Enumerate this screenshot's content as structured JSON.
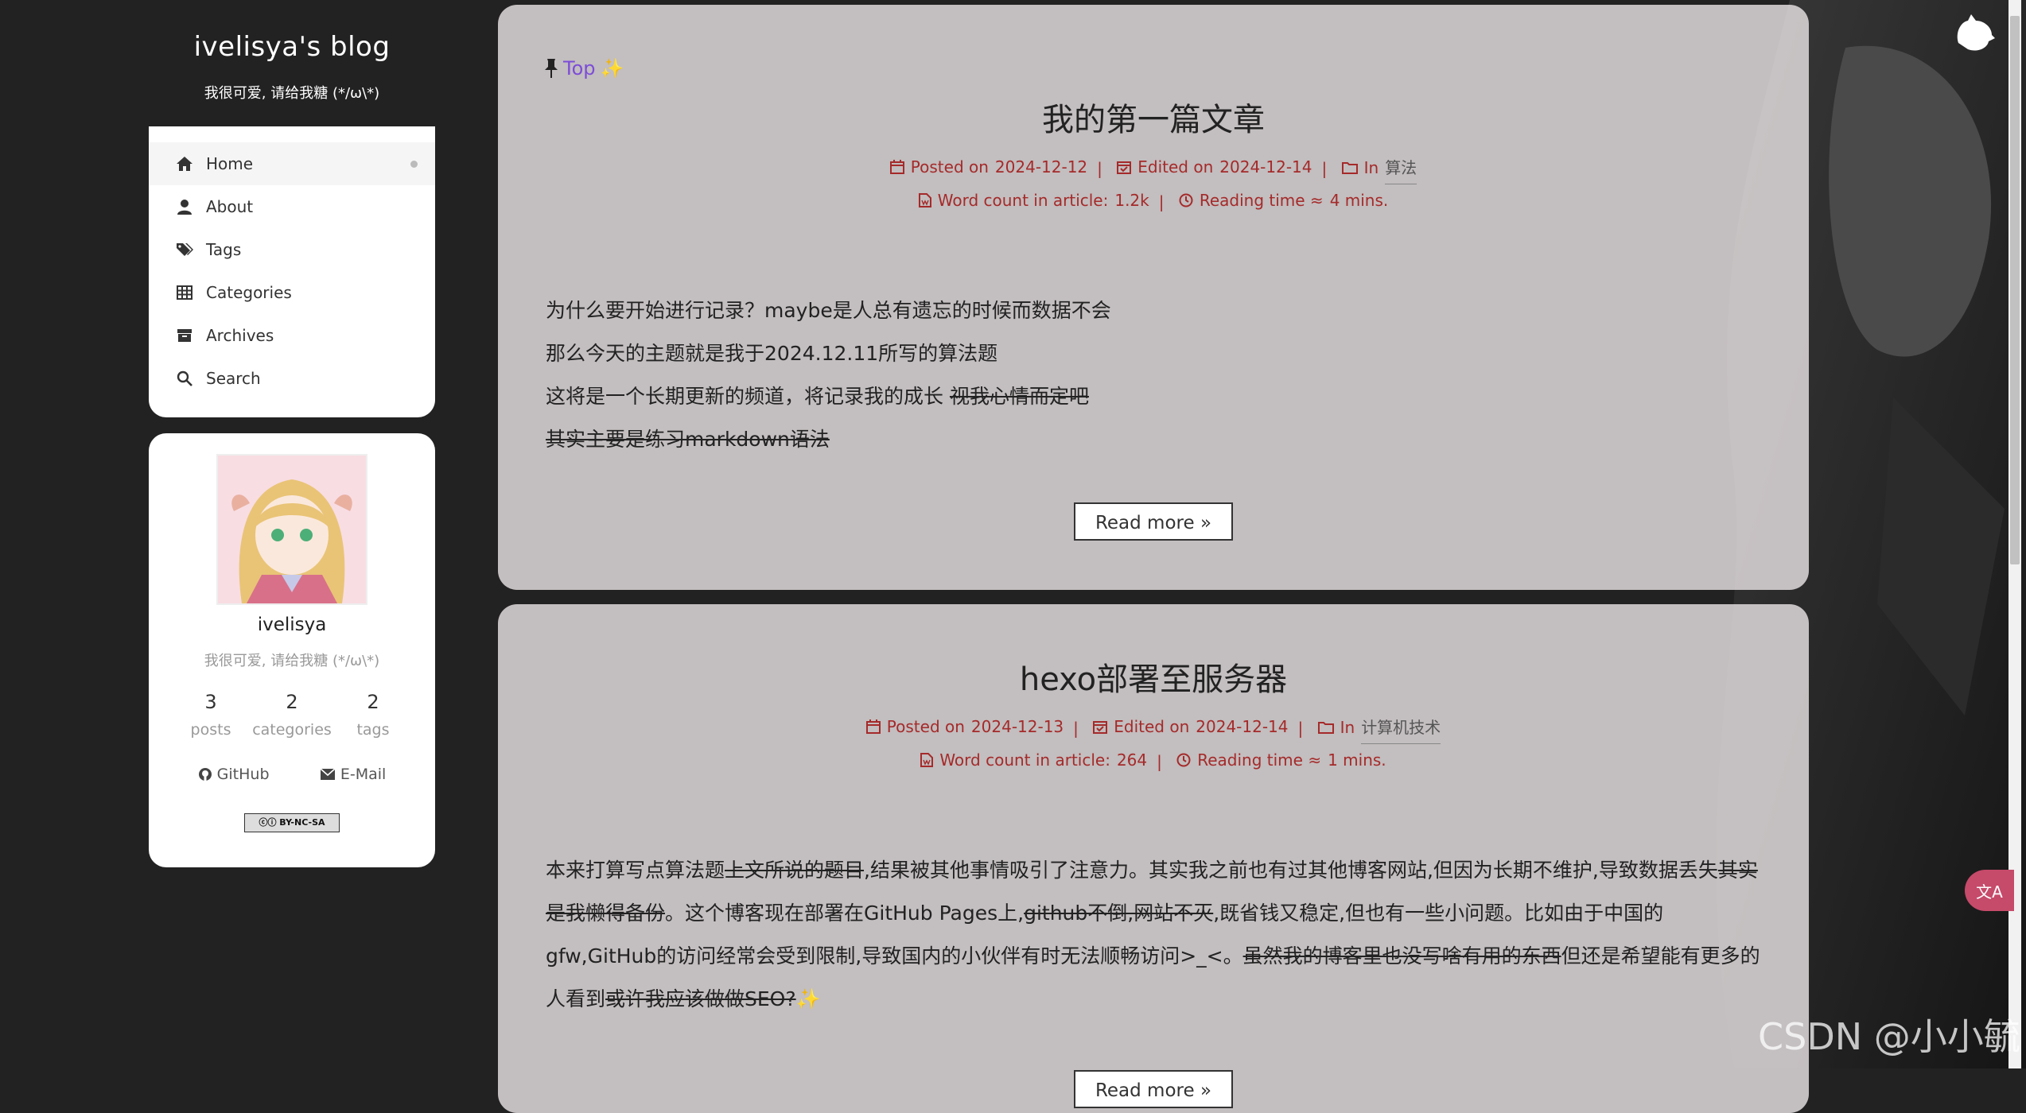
{
  "site": {
    "title": "ivelisya's blog",
    "subtitle": "我很可爱, 请给我糖 (*/ω\\*)"
  },
  "menu": [
    {
      "label": "Home",
      "icon": "home-icon",
      "active": true
    },
    {
      "label": "About",
      "icon": "user-icon"
    },
    {
      "label": "Tags",
      "icon": "tags-icon"
    },
    {
      "label": "Categories",
      "icon": "grid-icon"
    },
    {
      "label": "Archives",
      "icon": "archive-icon"
    },
    {
      "label": "Search",
      "icon": "search-icon"
    }
  ],
  "profile": {
    "name": "ivelisya",
    "description": "我很可爱, 请给我糖 (*/ω\\*)",
    "stats": [
      {
        "num": "3",
        "label": "posts"
      },
      {
        "num": "2",
        "label": "categories"
      },
      {
        "num": "2",
        "label": "tags"
      }
    ],
    "links": [
      {
        "label": "GitHub",
        "icon": "github-icon"
      },
      {
        "label": "E-Mail",
        "icon": "envelope-icon"
      }
    ],
    "license": "BY-NC-SA"
  },
  "posts": [
    {
      "pinned_label": "Top",
      "pinned_emoji": "✨",
      "title": "我的第一篇文章",
      "posted_label": "Posted on",
      "posted": "2024-12-12",
      "edited_label": "Edited on",
      "edited": "2024-12-14",
      "in_label": "In",
      "category": "算法",
      "wordcount_label": "Word count in article:",
      "wordcount": "1.2k",
      "readtime_label": "Reading time ≈",
      "readtime": "4 mins.",
      "lines": [
        {
          "text": "为什么要开始进行记录？maybe是人总有遗忘的时候而数据不会"
        },
        {
          "text": "那么今天的主题就是我于2024.12.11所写的算法题"
        },
        {
          "text": "这将是一个长期更新的频道，将记录我的成长 ",
          "strike": "视我心情而定吧"
        },
        {
          "text": "",
          "strike": "其实主要是练习markdown语法"
        }
      ],
      "readmore": "Read more »"
    },
    {
      "title": "hexo部署至服务器",
      "posted_label": "Posted on",
      "posted": "2024-12-13",
      "edited_label": "Edited on",
      "edited": "2024-12-14",
      "in_label": "In",
      "category": "计算机技术",
      "wordcount_label": "Word count in article:",
      "wordcount": "264",
      "readtime_label": "Reading time ≈",
      "readtime": "1 mins.",
      "p1": "本来打算写点算法题",
      "p1s": "上文所说的题目",
      "p2": ",结果被其他事情吸引了注意力。其实我之前也有过其他博客网站,但因为长期不维护,导致数据丢失",
      "p2s": "其实是我懒得备份",
      "p3": "。这个博客现在部署在GitHub Pages上,",
      "p3s": "github不倒,网站不灭",
      "p4": ",既省钱又稳定,但也有一些小问题。比如由于中国的gfw,GitHub的访问经常会受到限制,导致国内的小伙伴有时无法顺畅访问>_<。",
      "p4s": "虽然我的博客里也没写啥有用的东西",
      "p5": "但还是希望能有更多的人看到",
      "p5s": "或许我应该做做SEO?",
      "p6": "✨",
      "readmore": "Read more »"
    }
  ],
  "widgets": {
    "translate_label": "文A",
    "watermark": "CSDN @小小毓"
  },
  "colors": {
    "accent_meta": "#a52a2a",
    "pin_text": "#7c4dd8",
    "translate_bg": "#c64a6a"
  }
}
